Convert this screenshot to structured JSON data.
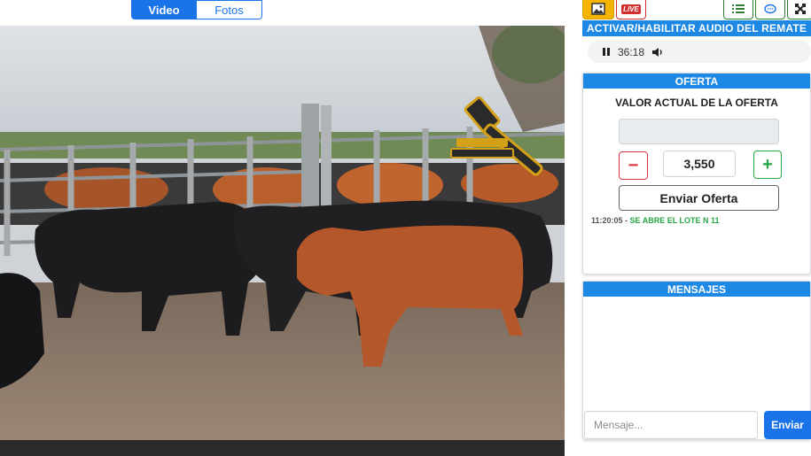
{
  "tabs": {
    "video": "Video",
    "fotos": "Fotos"
  },
  "toolbar": {
    "live_label": "LIVE"
  },
  "audio": {
    "header": "ACTIVAR/HABILITAR AUDIO DEL REMATE",
    "time": "36:18"
  },
  "oferta": {
    "header": "OFERTA",
    "valor_title": "VALOR ACTUAL DE LA OFERTA",
    "valor_actual": "",
    "cantidad": "3,550",
    "minus_label": "−",
    "plus_label": "+",
    "enviar_label": "Enviar Oferta",
    "log": [
      {
        "time": "11:20:05",
        "sep": " - ",
        "text": "SE ABRE EL LOTE N 11"
      }
    ]
  },
  "mensajes": {
    "header": "MENSAJES",
    "placeholder": "Mensaje...",
    "enviar_label": "Enviar"
  },
  "colors": {
    "primary": "#1a73e8",
    "header_blue": "#1e88e5",
    "minus_red": "#dc3545",
    "plus_green": "#28a745",
    "gavel_gold": "#d4a017"
  }
}
